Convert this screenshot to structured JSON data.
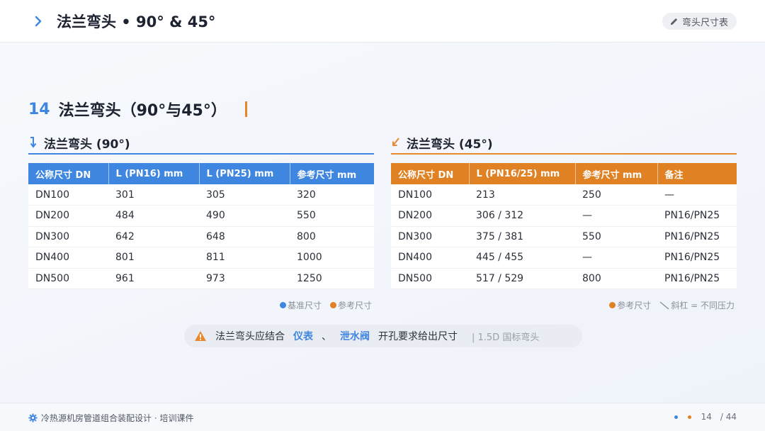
{
  "header": {
    "title": "法兰弯头 • 90° & 45°",
    "tag": "弯头尺寸表"
  },
  "section": {
    "number": "14",
    "title": "法兰弯头（90°与45°）"
  },
  "left_panel": {
    "title": "法兰弯头 (90°)",
    "columns": [
      "公称尺寸 DN",
      "L (PN16) mm",
      "L (PN25) mm",
      "参考尺寸 mm"
    ],
    "rows": [
      [
        "DN100",
        "301",
        "305",
        "320"
      ],
      [
        "DN200",
        "484",
        "490",
        "550"
      ],
      [
        "DN300",
        "642",
        "648",
        "800"
      ],
      [
        "DN400",
        "801",
        "811",
        "1000"
      ],
      [
        "DN500",
        "961",
        "973",
        "1250"
      ]
    ],
    "legend": [
      "基准尺寸",
      "参考尺寸"
    ]
  },
  "right_panel": {
    "title": "法兰弯头 (45°)",
    "columns": [
      "公称尺寸 DN",
      "L (PN16/25) mm",
      "参考尺寸 mm",
      "备注"
    ],
    "rows": [
      [
        "DN100",
        "213",
        "250",
        "—"
      ],
      [
        "DN200",
        "306 / 312",
        "—",
        "PN16/PN25"
      ],
      [
        "DN300",
        "375 / 381",
        "550",
        "PN16/PN25"
      ],
      [
        "DN400",
        "445 / 455",
        "—",
        "PN16/PN25"
      ],
      [
        "DN500",
        "517 / 529",
        "800",
        "PN16/PN25"
      ]
    ],
    "legend": [
      "参考尺寸",
      "斜杠 = 不同压力"
    ]
  },
  "note": {
    "prefix": "法兰弯头应结合",
    "hl1": "仪表",
    "sep": "、",
    "hl2": "泄水阀",
    "suffix": "开孔要求给出尺寸",
    "gray": "| 1.5D 国标弯头"
  },
  "footer": {
    "course": "冷热源机房管道组合装配设计 · 培训课件",
    "page": "14",
    "total": "/ 44"
  },
  "colors": {
    "blue": "#3f86e0",
    "orange": "#e08223"
  }
}
